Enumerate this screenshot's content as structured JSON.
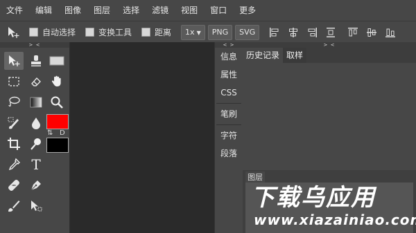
{
  "menu": [
    "文件",
    "编辑",
    "图像",
    "图层",
    "选择",
    "滤镜",
    "视图",
    "窗口",
    "更多"
  ],
  "options": {
    "auto_select": "自动选择",
    "transform_tools": "变换工具",
    "distance": "距离",
    "zoom": "1x",
    "png": "PNG",
    "svg": "SVG"
  },
  "tools_panel": {
    "collapse": "> <"
  },
  "colors": {
    "foreground": "#ff0000",
    "background": "#000000",
    "swap_glyph": "⇅",
    "default_label": "D"
  },
  "mini_panel": {
    "collapse": "< >",
    "items": [
      "信息",
      "属性",
      "CSS",
      "笔刷",
      "字符",
      "段落"
    ]
  },
  "history_panel": {
    "collapse": "> <",
    "tabs": [
      "历史记录",
      "取样"
    ],
    "layers_tab": "图层"
  },
  "watermark": {
    "line1": "下载乌应用",
    "line2": "www.xiazainiao.com"
  }
}
